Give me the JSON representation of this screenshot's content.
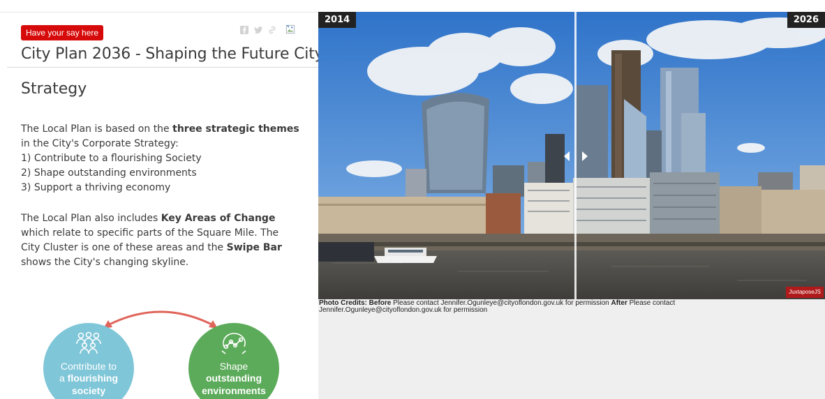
{
  "header": {
    "badge_label": "Have your say here",
    "share_icons": [
      "facebook-icon",
      "twitter-icon",
      "link-icon",
      "broken-image-icon"
    ],
    "title": "City Plan 2036 - Shaping the Future City"
  },
  "content": {
    "heading": "Strategy",
    "para1": {
      "intro": "The Local Plan is based on the ",
      "bold": "three strategic themes",
      "after": " in the City's Corporate Strategy:",
      "items": [
        "1) Contribute to a flourishing Society",
        "2) Shape outstanding environments",
        "3) Support a thriving economy"
      ]
    },
    "para2": {
      "t1": "The Local Plan also includes ",
      "b1": "Key Areas of Change",
      "t2": " which relate to specific parts of the Square Mile. The City Cluster is one of these areas and the ",
      "b2": "Swipe Bar",
      "t3": " shows the City's changing skyline."
    }
  },
  "diagram": {
    "society": {
      "line1": "Contribute to",
      "line2_a": "a ",
      "line2_b": "flourishing",
      "line3": "society",
      "icon": "people-group-icon"
    },
    "environments": {
      "line1": "Shape",
      "line2": "outstanding",
      "line3": "environments",
      "icon": "network-nodes-icon"
    },
    "colors": {
      "society": "#7fc6d8",
      "environments": "#5cab5a",
      "arrow": "#e0645a"
    }
  },
  "slider": {
    "before_label": "2014",
    "after_label": "2026",
    "badge": "JuxtaposeJS",
    "credits": {
      "prefix": "Photo Credits: ",
      "before_label": "Before",
      "before_text": " Please contact Jennifer.Ogunleye@cityoflondon.gov.uk for permission ",
      "after_label": "After",
      "after_text": " Please contact Jennifer.Ogunleye@cityoflondon.gov.uk for permission"
    }
  },
  "colors": {
    "badge": "#d60a0a",
    "panel_bg": "#efefef"
  }
}
